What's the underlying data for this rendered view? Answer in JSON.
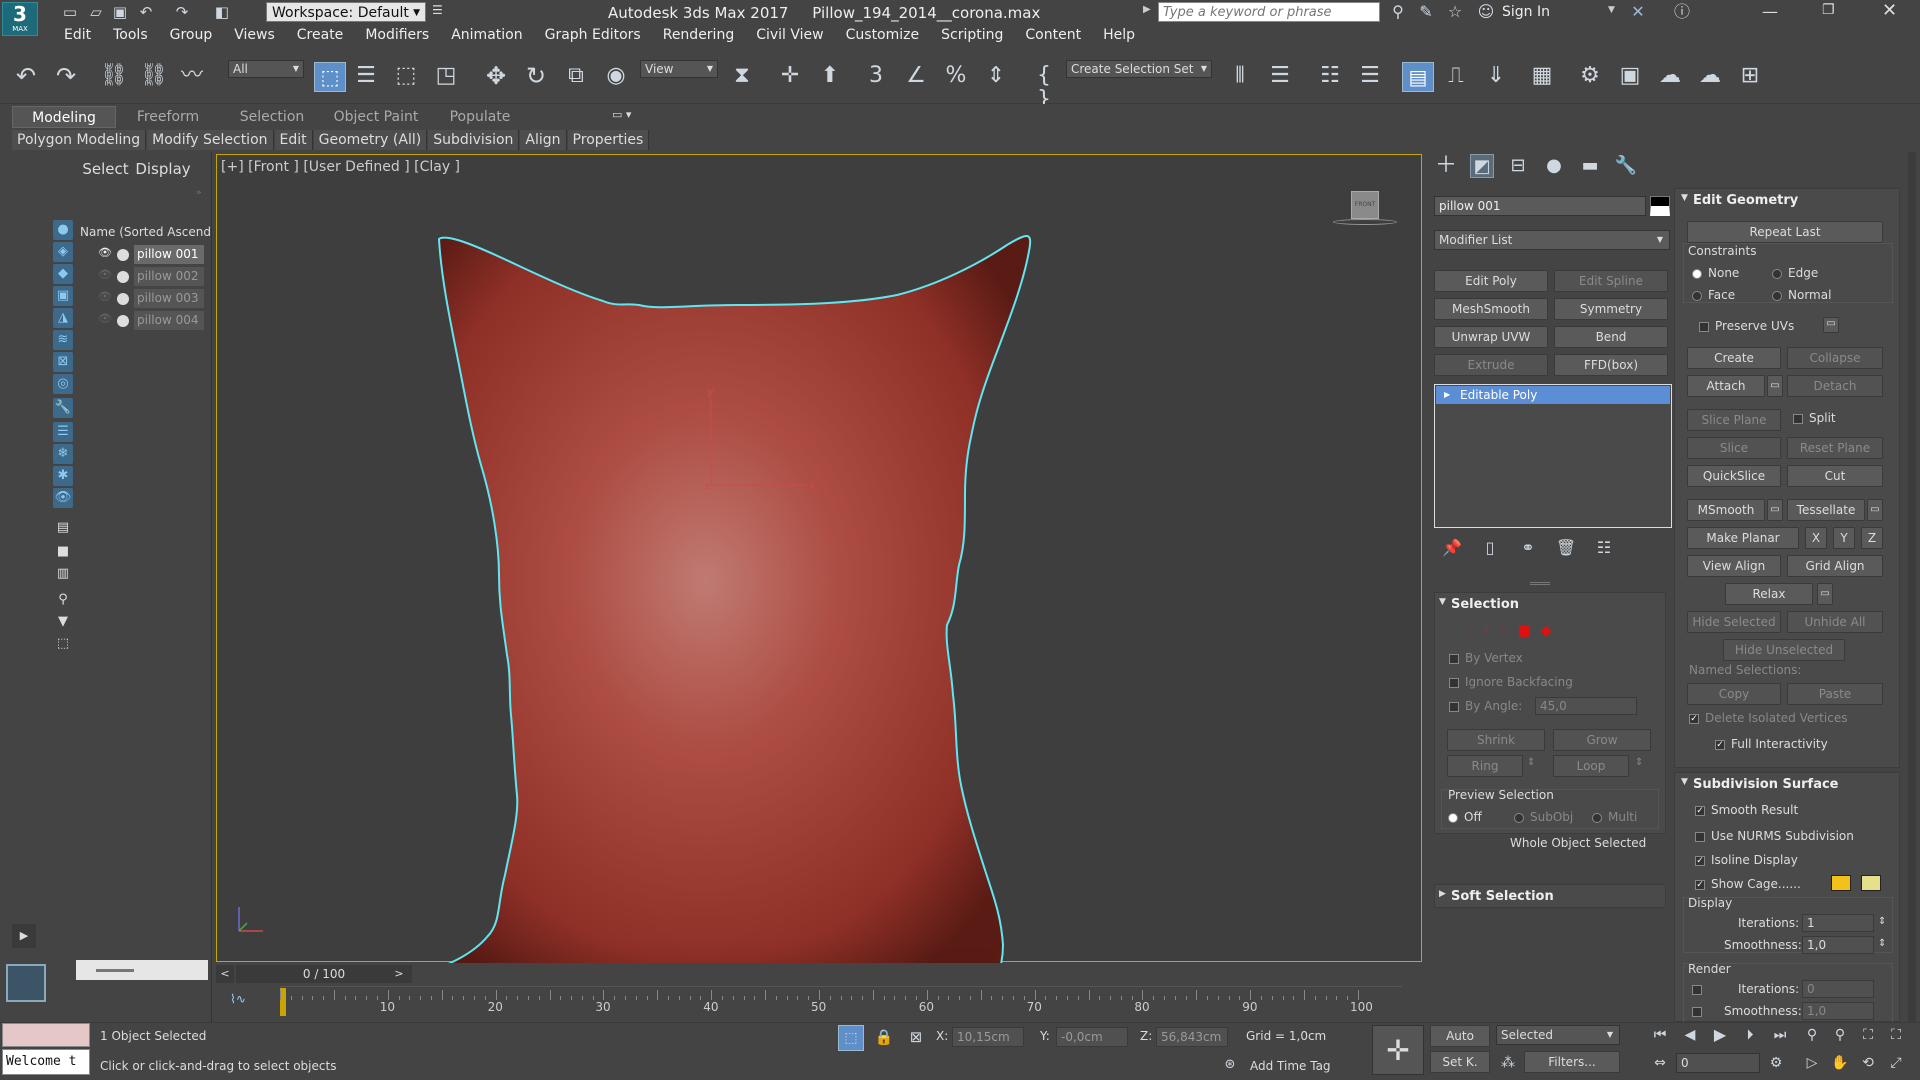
{
  "titlebar": {
    "workspace": "Workspace: Default",
    "app_title": "Autodesk 3ds Max 2017",
    "file_name": "Pillow_194_2014__corona.max",
    "search_placeholder": "Type a keyword or phrase",
    "sign_in": "Sign In",
    "app_logo_text": "3",
    "app_logo_sub": "MAX"
  },
  "menu": [
    "Edit",
    "Tools",
    "Group",
    "Views",
    "Create",
    "Modifiers",
    "Animation",
    "Graph Editors",
    "Rendering",
    "Civil View",
    "Customize",
    "Scripting",
    "Content",
    "Help"
  ],
  "toolbar": {
    "filter": "All",
    "ref_coord": "View",
    "selection_set": "Create Selection Set",
    "snap_label": "3"
  },
  "ribbon_tabs": [
    "Modeling",
    "Freeform",
    "Selection",
    "Object Paint",
    "Populate"
  ],
  "ribbon_sub": [
    "Polygon Modeling",
    "Modify Selection",
    "Edit",
    "Geometry (All)",
    "Subdivision",
    "Align",
    "Properties"
  ],
  "scene_explorer": {
    "tabs": [
      "Select",
      "Display"
    ],
    "column": "Name (Sorted Ascendi",
    "items": [
      "pillow 001",
      "pillow 002",
      "pillow 003",
      "pillow 004"
    ]
  },
  "viewport": {
    "label": "[+] [Front ] [User Defined ] [Clay ]",
    "gizmo_y": "y",
    "gizmo_x": "x",
    "gizmo_z": "z",
    "viewcube": "FRONT",
    "fill_color": "#b2473d",
    "outline_color": "#5fe6f0"
  },
  "timeline": {
    "frame": "0 / 100",
    "prev": "<",
    "next": ">",
    "ticks": [
      "10",
      "20",
      "30",
      "40",
      "50",
      "60",
      "70",
      "80",
      "90",
      "100"
    ]
  },
  "command_panel": {
    "object_name": "pillow 001",
    "modifier_list": "Modifier List",
    "modifier_buttons": [
      "Edit Poly",
      "Edit Spline",
      "MeshSmooth",
      "Symmetry",
      "Unwrap UVW",
      "Bend",
      "Extrude",
      "FFD(box)"
    ],
    "stack_item": "Editable Poly",
    "selection": {
      "title": "Selection",
      "by_vertex": "By Vertex",
      "ignore_backfacing": "Ignore Backfacing",
      "by_angle": "By Angle:",
      "angle_value": "45,0",
      "shrink": "Shrink",
      "grow": "Grow",
      "ring": "Ring",
      "loop": "Loop",
      "preview": "Preview Selection",
      "preview_opts": [
        "Off",
        "SubObj",
        "Multi"
      ],
      "status": "Whole Object Selected"
    },
    "soft_selection": "Soft Selection"
  },
  "edit_geometry": {
    "title": "Edit Geometry",
    "repeat_last": "Repeat Last",
    "constraints": "Constraints",
    "constraint_opts": [
      "None",
      "Edge",
      "Face",
      "Normal"
    ],
    "preserve_uvs": "Preserve UVs",
    "create": "Create",
    "collapse": "Collapse",
    "attach": "Attach",
    "detach": "Detach",
    "slice_plane": "Slice Plane",
    "split": "Split",
    "slice": "Slice",
    "reset_plane": "Reset Plane",
    "quickslice": "QuickSlice",
    "cut": "Cut",
    "msmooth": "MSmooth",
    "tessellate": "Tessellate",
    "make_planar": "Make Planar",
    "x": "X",
    "y": "Y",
    "z": "Z",
    "view_align": "View Align",
    "grid_align": "Grid Align",
    "relax": "Relax",
    "hide_selected": "Hide Selected",
    "unhide_all": "Unhide All",
    "hide_unselected": "Hide Unselected",
    "named_selections": "Named Selections:",
    "copy": "Copy",
    "paste": "Paste",
    "delete_isolated": "Delete Isolated Vertices",
    "full_interactivity": "Full Interactivity"
  },
  "subdivision": {
    "title": "Subdivision Surface",
    "smooth_result": "Smooth Result",
    "use_nurms": "Use NURMS Subdivision",
    "isoline": "Isoline Display",
    "show_cage": "Show Cage......",
    "display": "Display",
    "iterations": "Iterations:",
    "iterations_val": "1",
    "smoothness": "Smoothness:",
    "smoothness_val": "1,0",
    "render": "Render",
    "render_iter_val": "0",
    "render_smooth_val": "1,0",
    "cage_color1": "#f2c21a",
    "cage_color2": "#e6e08a"
  },
  "status": {
    "selected": "1 Object Selected",
    "prompt": "Click or click-and-drag to select objects",
    "maxscript": "Welcome t",
    "x_label": "X:",
    "x_val": "10,15cm",
    "y_label": "Y:",
    "y_val": "-0,0cm",
    "z_label": "Z:",
    "z_val": "56,843cm",
    "grid": "Grid = 1,0cm",
    "add_time_tag": "Add Time Tag",
    "auto": "Auto",
    "set_k": "Set K.",
    "selected_dd": "Selected",
    "filters": "Filters...",
    "frame_field": "0"
  }
}
